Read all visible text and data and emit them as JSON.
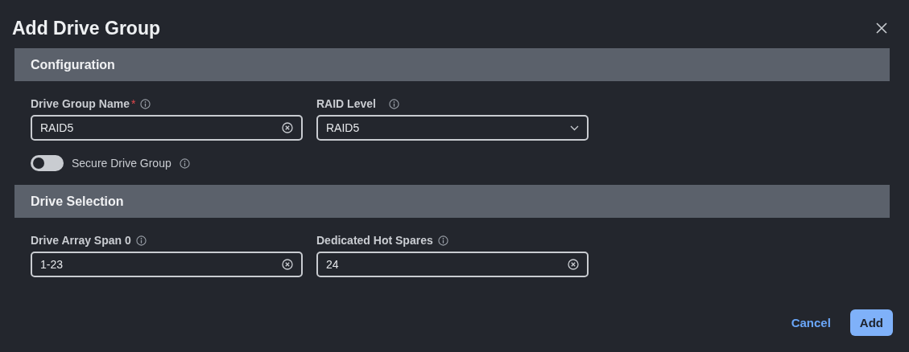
{
  "dialog": {
    "title": "Add Drive Group"
  },
  "sections": [
    {
      "title": "Configuration",
      "fields": [
        {
          "kind": "text",
          "label": "Drive Group Name",
          "required_mark": "*",
          "value": "RAID5"
        },
        {
          "kind": "select",
          "label": "RAID Level",
          "value": "RAID5"
        }
      ],
      "toggle": {
        "label": "Secure Drive Group",
        "on": false
      }
    },
    {
      "title": "Drive Selection",
      "fields": [
        {
          "kind": "text",
          "label": "Drive Array Span 0",
          "value": "1-23"
        },
        {
          "kind": "text",
          "label": "Dedicated Hot Spares",
          "value": "24"
        }
      ]
    }
  ],
  "buttons": [
    {
      "kind": "link",
      "label": "Cancel"
    },
    {
      "kind": "primary",
      "label": "Add"
    }
  ]
}
